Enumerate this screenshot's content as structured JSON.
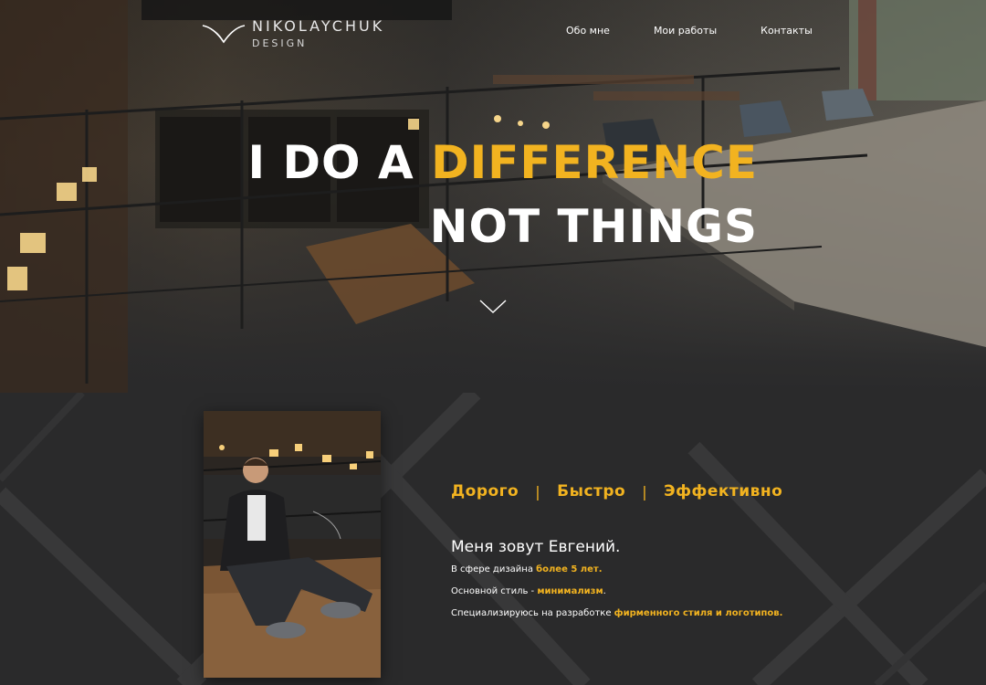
{
  "header": {
    "logo_name": "NIKOLAYCHUK",
    "logo_sub": "DESIGN",
    "nav": [
      {
        "label": "Обо мне"
      },
      {
        "label": "Мои работы"
      },
      {
        "label": "Контакты"
      }
    ]
  },
  "hero": {
    "line1_prefix": "I DO A ",
    "line1_accent": "DIFFERENCE",
    "line2": "NOT THINGS"
  },
  "about": {
    "tags": [
      "Дорого",
      "Быстро",
      "Эффективно"
    ],
    "tag_separator": "|",
    "intro": "Меня зовут Евгений.",
    "facts": [
      {
        "text": "В сфере дизайна ",
        "highlight": "более 5 лет.",
        "suffix": ""
      },
      {
        "text": "Основной стиль - ",
        "highlight": "минимализм",
        "suffix": "."
      },
      {
        "text": "Специализируюсь на разработке ",
        "highlight": "фирменного стиля и логотипов.",
        "suffix": ""
      }
    ]
  },
  "colors": {
    "accent": "#f2b320",
    "background": "#2a2a2b",
    "text": "#ffffff"
  },
  "icons": {
    "logo": "v-mark-logo-icon",
    "scroll": "chevron-down-icon"
  }
}
